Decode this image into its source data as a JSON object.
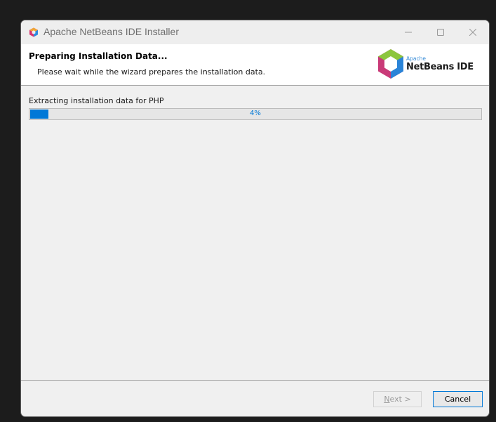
{
  "window": {
    "title": "Apache NetBeans IDE Installer",
    "icon": "netbeans-cube-icon",
    "controls": [
      "minimize-icon",
      "maximize-icon",
      "close-icon"
    ]
  },
  "header": {
    "title": "Preparing Installation Data...",
    "subtitle": "Please wait while the wizard prepares the installation data.",
    "logo_brand": "Apache",
    "logo_name": "NetBeans IDE"
  },
  "status": {
    "text": "Extracting installation data for PHP",
    "progress_label": "4%",
    "progress_value": 0.04
  },
  "buttons": {
    "next_prefix": "N",
    "next_rest": "ext >",
    "next_enabled": false,
    "cancel": "Cancel"
  },
  "colors": {
    "accent": "#0078d7",
    "header_bg": "#ffffff",
    "body_bg": "#f0f0f0"
  }
}
